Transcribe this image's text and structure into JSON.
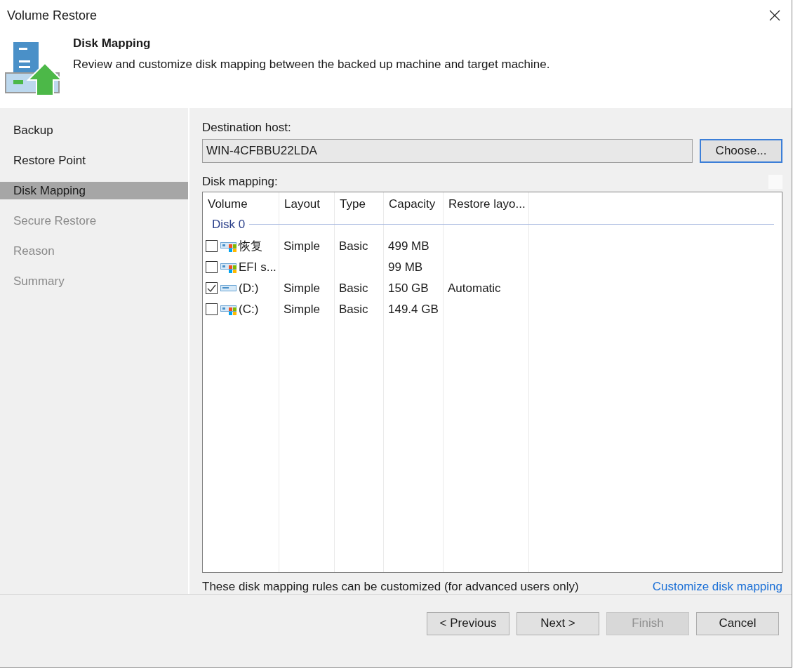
{
  "window": {
    "title": "Volume Restore"
  },
  "header": {
    "title": "Disk Mapping",
    "description": "Review and customize disk mapping between the backed up machine and target machine."
  },
  "steps": [
    {
      "label": "Backup",
      "selected": false,
      "disabled": false
    },
    {
      "label": "Restore Point",
      "selected": false,
      "disabled": false
    },
    {
      "label": "Disk Mapping",
      "selected": true,
      "disabled": false
    },
    {
      "label": "Secure Restore",
      "selected": false,
      "disabled": true
    },
    {
      "label": "Reason",
      "selected": false,
      "disabled": true
    },
    {
      "label": "Summary",
      "selected": false,
      "disabled": true
    }
  ],
  "destination": {
    "label": "Destination host:",
    "value": "WIN-4CFBBU22LDA",
    "button": {
      "label": "Choose...",
      "focused": true
    }
  },
  "mapping": {
    "label": "Disk mapping:",
    "columns": [
      "Volume",
      "Layout",
      "Type",
      "Capacity",
      "Restore layo..."
    ],
    "group": "Disk 0",
    "rows": [
      {
        "kind": "windows",
        "checked": false,
        "cells": [
          "恢复",
          "Simple",
          "Basic",
          "499 MB",
          ""
        ]
      },
      {
        "kind": "windows",
        "checked": false,
        "cells": [
          "EFI s...",
          "",
          "",
          "99 MB",
          ""
        ]
      },
      {
        "kind": "plain",
        "checked": true,
        "cells": [
          "(D:)",
          "Simple",
          "Basic",
          "150 GB",
          "Automatic"
        ]
      },
      {
        "kind": "windows",
        "checked": false,
        "cells": [
          "(C:)",
          "Simple",
          "Basic",
          "149.4 GB",
          ""
        ]
      }
    ]
  },
  "note": "These disk mapping rules can be customized (for advanced users only)",
  "link": "Customize disk mapping",
  "buttons": [
    {
      "label": "< Previous",
      "disabled": false
    },
    {
      "label": "Next >",
      "disabled": false
    },
    {
      "label": "Finish",
      "disabled": true
    },
    {
      "label": "Cancel",
      "disabled": false
    }
  ]
}
